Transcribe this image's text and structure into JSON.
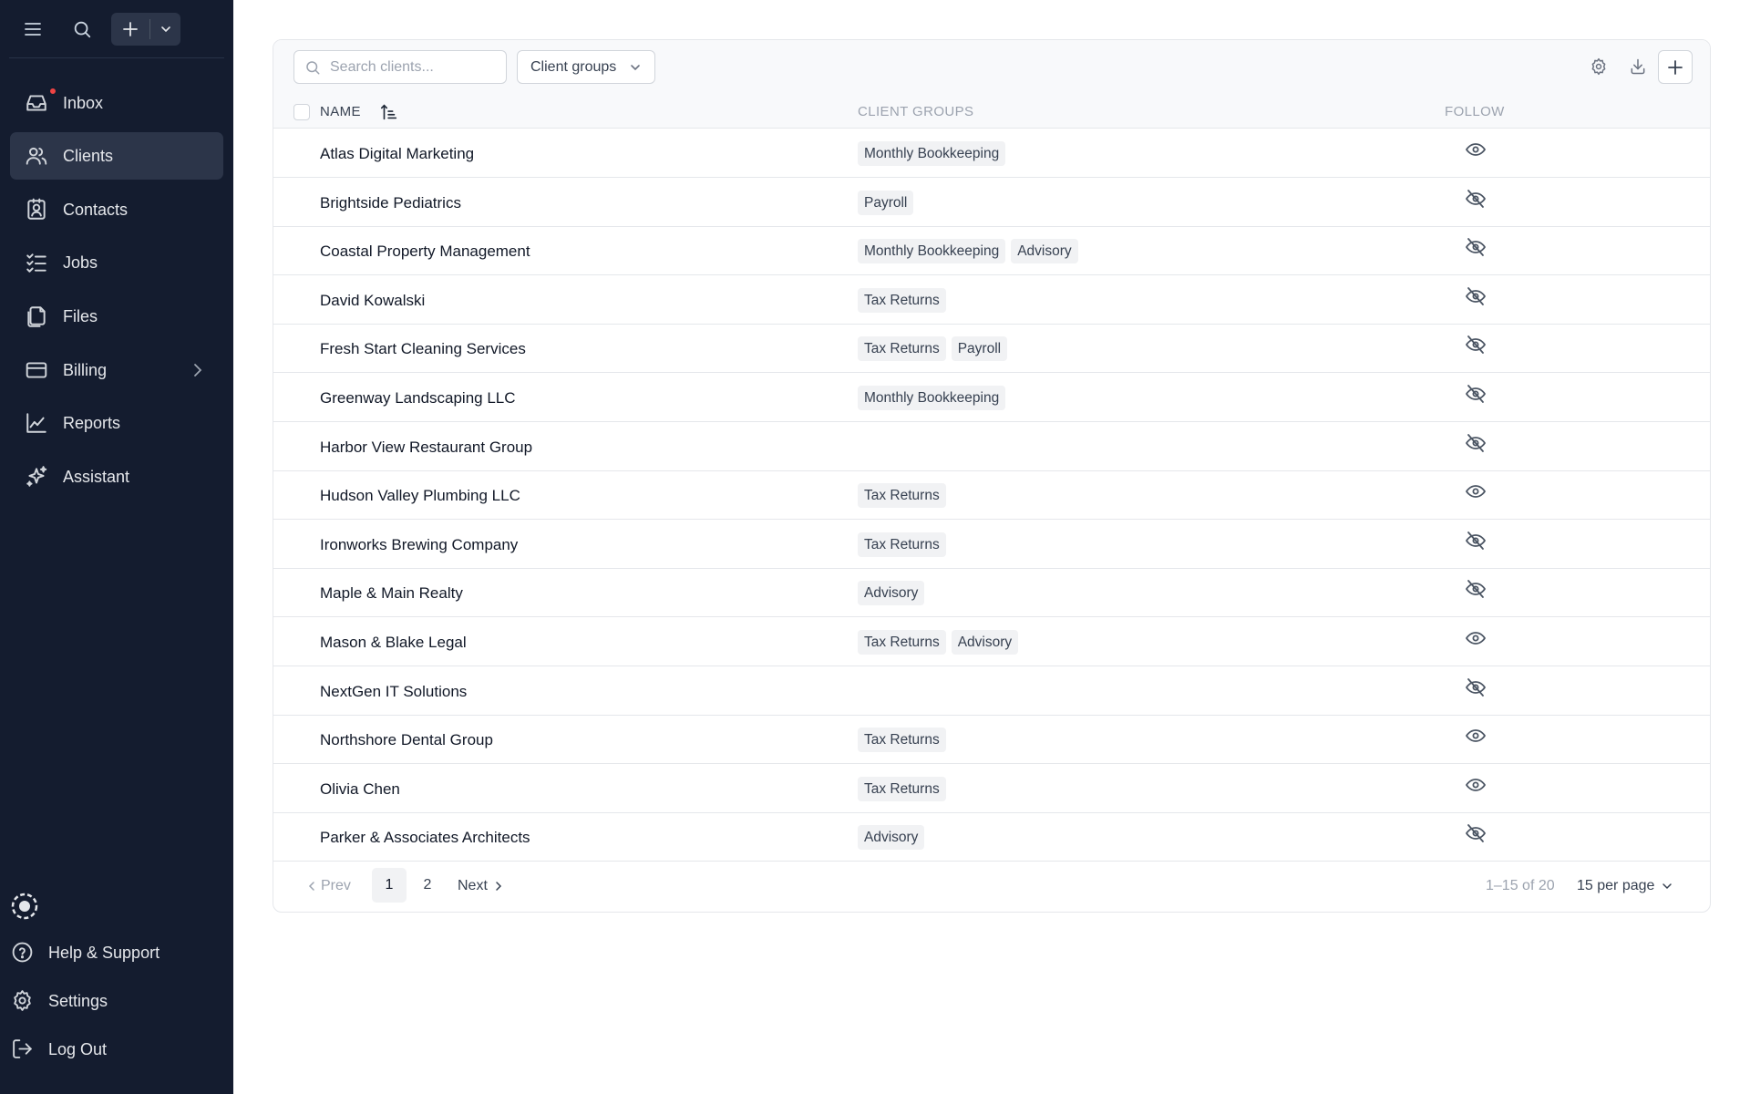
{
  "header": {
    "menu_icon": "hamburger-icon",
    "search_icon": "search-icon",
    "create_icon": "plus-icon"
  },
  "sidebar": {
    "items": [
      {
        "label": "Inbox",
        "icon": "inbox-icon",
        "active": false,
        "has_badge": true
      },
      {
        "label": "Clients",
        "icon": "users-icon",
        "active": true
      },
      {
        "label": "Contacts",
        "icon": "contact-card-icon",
        "active": false
      },
      {
        "label": "Jobs",
        "icon": "checklist-icon",
        "active": false
      },
      {
        "label": "Files",
        "icon": "files-icon",
        "active": false
      },
      {
        "label": "Billing",
        "icon": "credit-card-icon",
        "active": false,
        "has_submenu": true
      },
      {
        "label": "Reports",
        "icon": "chart-line-icon",
        "active": false
      },
      {
        "label": "Assistant",
        "icon": "sparkles-icon",
        "active": false
      }
    ],
    "bottom": [
      {
        "label": "Help & Support",
        "icon": "help-circle-icon"
      },
      {
        "label": "Settings",
        "icon": "gear-icon"
      },
      {
        "label": "Log Out",
        "icon": "logout-icon"
      }
    ]
  },
  "toolbar": {
    "search_placeholder": "Search clients...",
    "client_groups_label": "Client groups"
  },
  "table": {
    "columns": {
      "name": "NAME",
      "groups": "CLIENT GROUPS",
      "follow": "FOLLOW"
    },
    "rows": [
      {
        "name": "Atlas Digital Marketing",
        "groups": [
          "Monthly Bookkeeping"
        ],
        "following": true
      },
      {
        "name": "Brightside Pediatrics",
        "groups": [
          "Payroll"
        ],
        "following": false
      },
      {
        "name": "Coastal Property Management",
        "groups": [
          "Monthly Bookkeeping",
          "Advisory"
        ],
        "following": false
      },
      {
        "name": "David Kowalski",
        "groups": [
          "Tax Returns"
        ],
        "following": false
      },
      {
        "name": "Fresh Start Cleaning Services",
        "groups": [
          "Tax Returns",
          "Payroll"
        ],
        "following": false
      },
      {
        "name": "Greenway Landscaping LLC",
        "groups": [
          "Monthly Bookkeeping"
        ],
        "following": false
      },
      {
        "name": "Harbor View Restaurant Group",
        "groups": [],
        "following": false
      },
      {
        "name": "Hudson Valley Plumbing LLC",
        "groups": [
          "Tax Returns"
        ],
        "following": true
      },
      {
        "name": "Ironworks Brewing Company",
        "groups": [
          "Tax Returns"
        ],
        "following": false
      },
      {
        "name": "Maple & Main Realty",
        "groups": [
          "Advisory"
        ],
        "following": false
      },
      {
        "name": "Mason & Blake Legal",
        "groups": [
          "Tax Returns",
          "Advisory"
        ],
        "following": true
      },
      {
        "name": "NextGen IT Solutions",
        "groups": [],
        "following": false
      },
      {
        "name": "Northshore Dental Group",
        "groups": [
          "Tax Returns"
        ],
        "following": true
      },
      {
        "name": "Olivia Chen",
        "groups": [
          "Tax Returns"
        ],
        "following": true
      },
      {
        "name": "Parker & Associates Architects",
        "groups": [
          "Advisory"
        ],
        "following": false
      }
    ]
  },
  "pagination": {
    "prev_label": "Prev",
    "pages": [
      "1",
      "2"
    ],
    "current_page": "1",
    "next_label": "Next",
    "range_text": "1–15 of 20",
    "per_page_label": "15 per page"
  },
  "colors": {
    "sidebar_bg": "#141c2f",
    "sidebar_active": "#2c3549",
    "badge": "#ef4444",
    "muted_text": "#6b7280",
    "tag_bg": "#f1f2f4"
  }
}
